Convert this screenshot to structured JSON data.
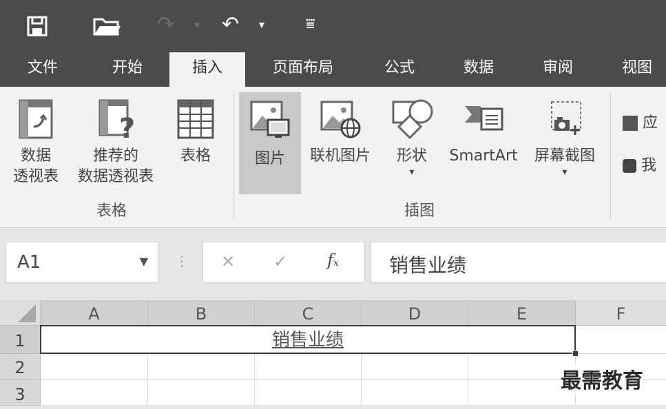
{
  "qat": {
    "save_icon": "save-icon",
    "open_icon": "open-folder-icon",
    "redo_icon": "redo-icon",
    "undo_icon": "undo-icon",
    "customize_icon": "customize-qat-icon"
  },
  "tabs": [
    "文件",
    "开始",
    "插入",
    "页面布局",
    "公式",
    "数据",
    "审阅",
    "视图"
  ],
  "active_tab": "插入",
  "ribbon": {
    "pivot_line1": "数据",
    "pivot_line2": "透视表",
    "rec_line1": "推荐的",
    "rec_line2": "数据透视表",
    "table": "表格",
    "group_tables": "表格",
    "picture": "图片",
    "online_picture": "联机图片",
    "shapes": "形状",
    "smartart": "SmartArt",
    "screenshot": "屏幕截图",
    "group_illustrations": "插图",
    "right_partial_1": "应",
    "right_partial_2": "我"
  },
  "formula_bar": {
    "name_box": "A1",
    "cancel": "✕",
    "enter": "✓",
    "fx": "fx",
    "content": "销售业绩"
  },
  "grid": {
    "columns": [
      "A",
      "B",
      "C",
      "D",
      "E",
      "F"
    ],
    "rows": [
      "1",
      "2",
      "3"
    ],
    "merged_a1": "销售业绩"
  },
  "watermark": "最需教育"
}
